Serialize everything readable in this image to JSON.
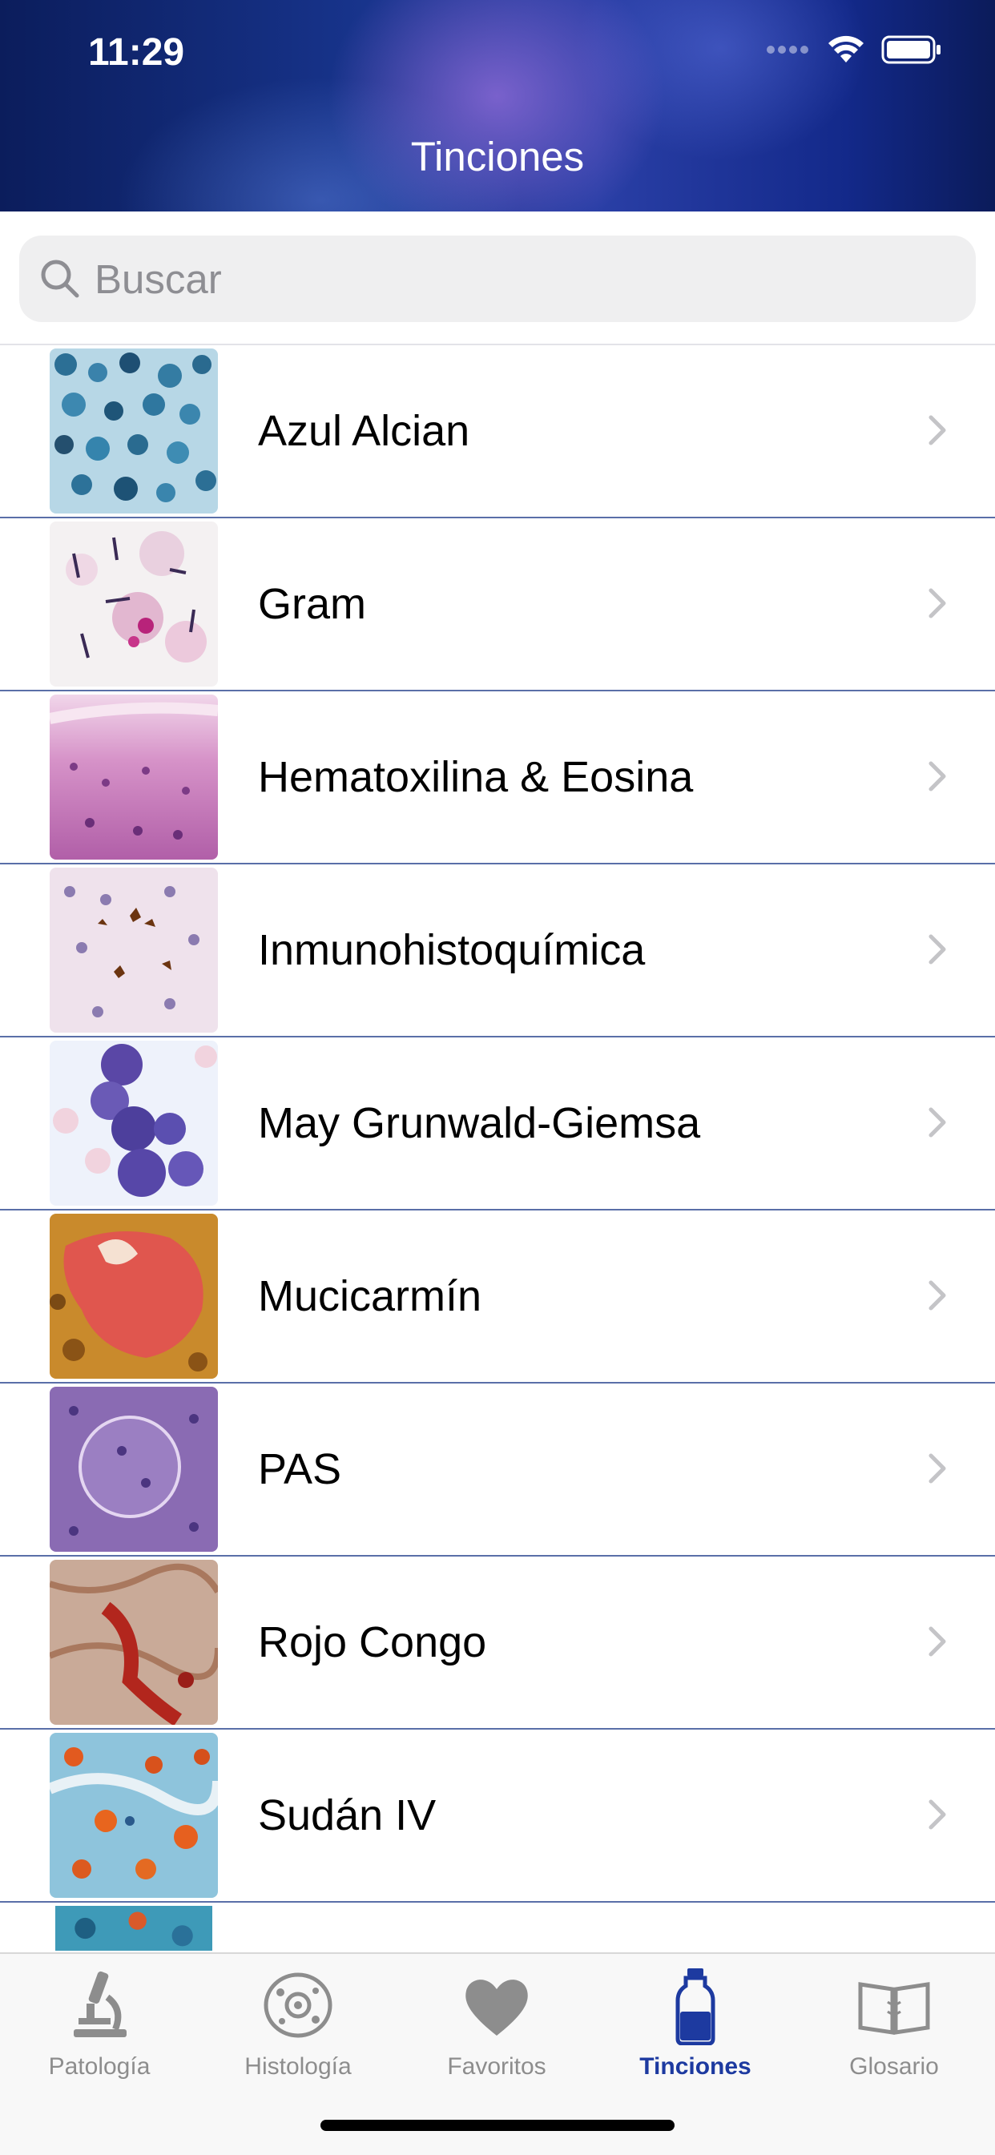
{
  "status_bar": {
    "time": "11:29"
  },
  "nav": {
    "title": "Tinciones"
  },
  "search": {
    "placeholder": "Buscar"
  },
  "items": [
    {
      "label": "Azul Alcian",
      "thumb": "alcian"
    },
    {
      "label": "Gram",
      "thumb": "gram"
    },
    {
      "label": "Hematoxilina & Eosina",
      "thumb": "he"
    },
    {
      "label": "Inmunohistoquímica",
      "thumb": "ihq"
    },
    {
      "label": "May Grunwald-Giemsa",
      "thumb": "mgg"
    },
    {
      "label": "Mucicarmín",
      "thumb": "muci"
    },
    {
      "label": "PAS",
      "thumb": "pas"
    },
    {
      "label": "Rojo Congo",
      "thumb": "congo"
    },
    {
      "label": "Sudán IV",
      "thumb": "sudan"
    }
  ],
  "tabs": [
    {
      "label": "Patología",
      "icon": "microscope-icon"
    },
    {
      "label": "Histología",
      "icon": "cell-icon"
    },
    {
      "label": "Favoritos",
      "icon": "heart-icon"
    },
    {
      "label": "Tinciones",
      "icon": "stain-bottle-icon",
      "active": true
    },
    {
      "label": "Glosario",
      "icon": "book-icon"
    }
  ],
  "colors": {
    "accent": "#1d3aa0",
    "tab_inactive": "#8d8d8d",
    "separator": "#5a6fa8"
  }
}
